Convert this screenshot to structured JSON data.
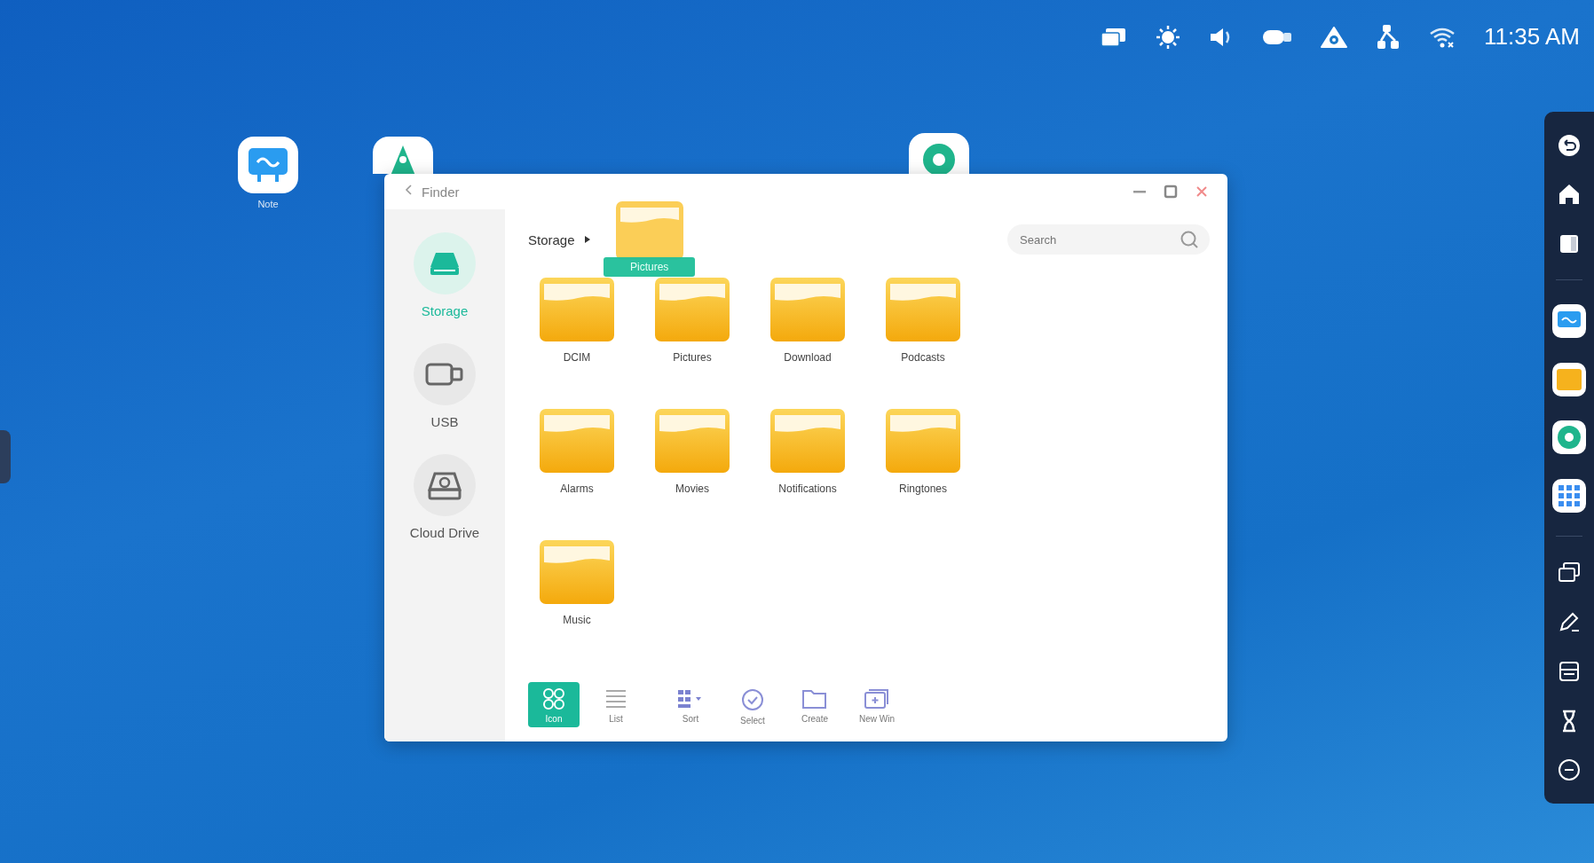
{
  "status_bar": {
    "time": "11:35 AM"
  },
  "desktop_icons": [
    {
      "kind": "whiteboard",
      "label": "Note"
    },
    {
      "kind": "bell"
    },
    {
      "kind": "ring"
    }
  ],
  "window": {
    "title": "Finder"
  },
  "sidebar": {
    "items": [
      {
        "kind": "storage",
        "label": "Storage",
        "selected": true
      },
      {
        "kind": "usb",
        "label": "USB",
        "selected": false
      },
      {
        "kind": "cloud",
        "label": "Cloud Drive",
        "selected": false
      }
    ]
  },
  "breadcrumb": {
    "label": "Storage"
  },
  "search": {
    "placeholder": "Search"
  },
  "dragged_folder": {
    "label": "Pictures"
  },
  "folders": [
    "DCIM",
    "Pictures",
    "Download",
    "Podcasts",
    "Alarms",
    "Movies",
    "Notifications",
    "Ringtones",
    "Music"
  ],
  "toolbar": [
    {
      "kind": "grid",
      "label": "Icon",
      "selected": true
    },
    {
      "kind": "list",
      "label": "List",
      "selected": false
    },
    {
      "kind": "sort",
      "label": "Sort",
      "selected": false
    },
    {
      "kind": "select",
      "label": "Select",
      "selected": false
    },
    {
      "kind": "create",
      "label": "Create",
      "selected": false
    },
    {
      "kind": "newwin",
      "label": "New Win",
      "selected": false
    }
  ]
}
